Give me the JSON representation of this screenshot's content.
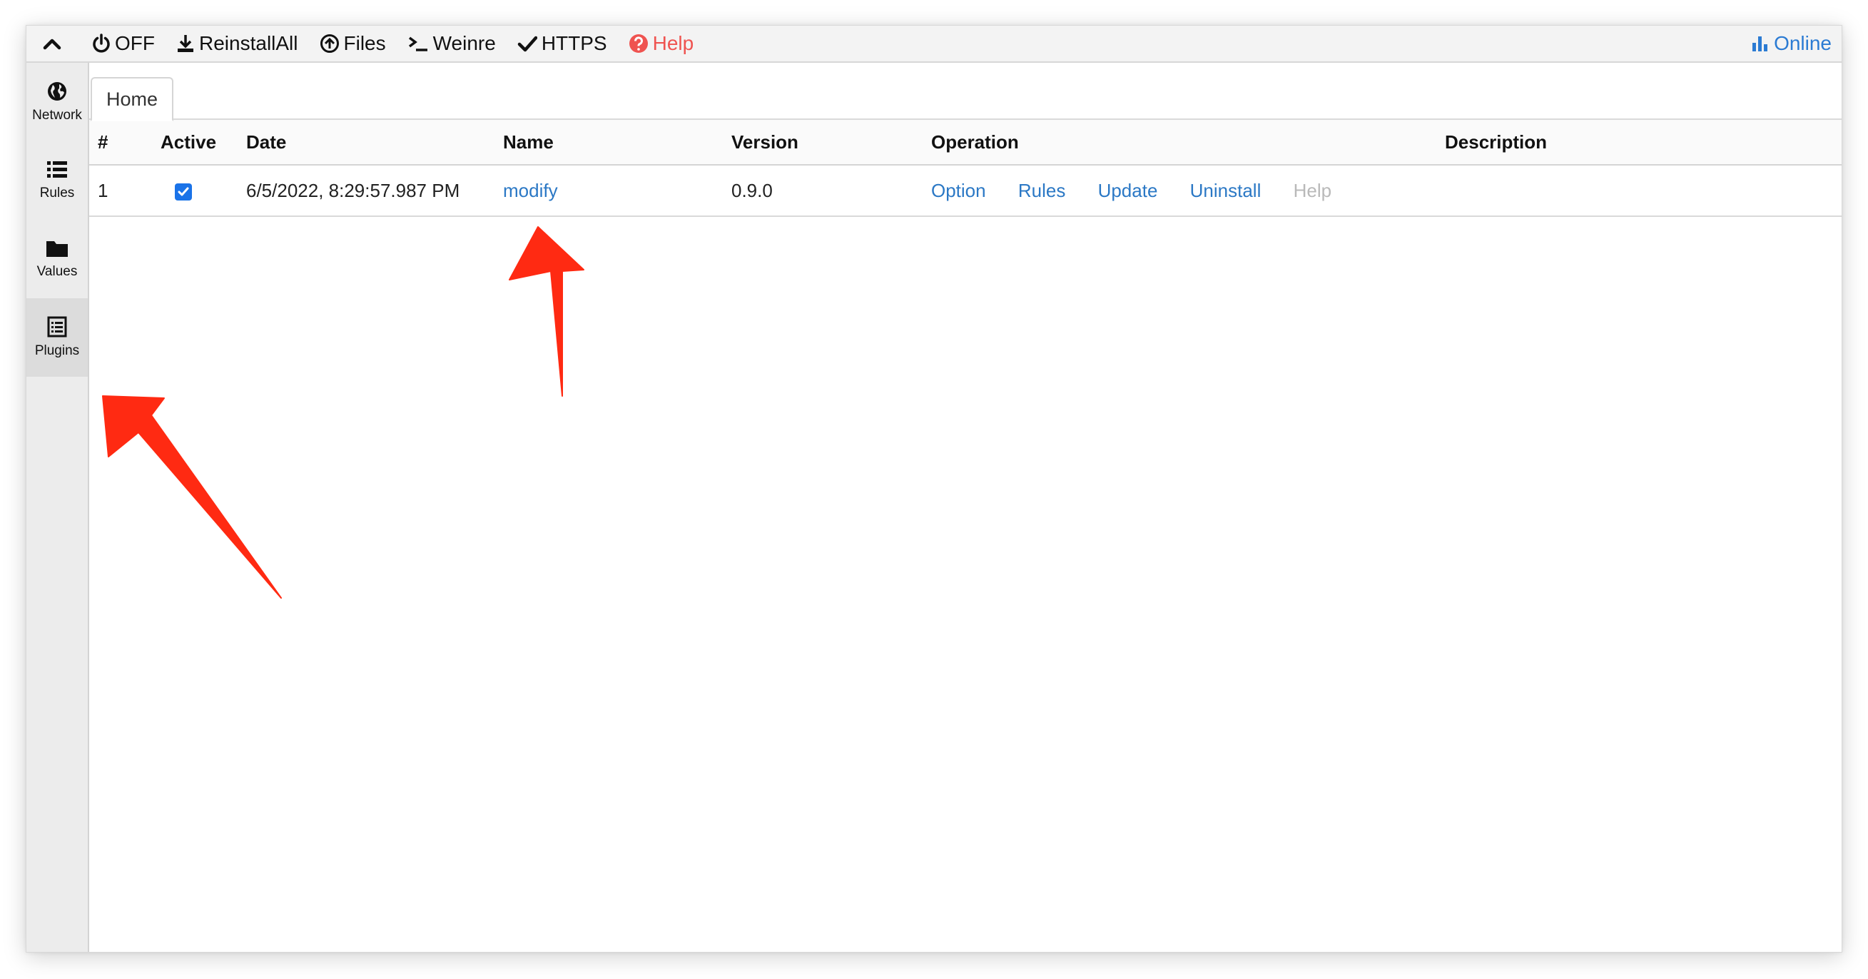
{
  "toolbar": {
    "items": [
      {
        "label": "OFF",
        "icon": "power-icon"
      },
      {
        "label": "ReinstallAll",
        "icon": "download-icon"
      },
      {
        "label": "Files",
        "icon": "upload-circle-icon"
      },
      {
        "label": "Weinre",
        "icon": "terminal-icon"
      },
      {
        "label": "HTTPS",
        "icon": "check-icon"
      },
      {
        "label": "Help",
        "icon": "question-circle-icon"
      }
    ],
    "online_label": "Online"
  },
  "sidebar": {
    "items": [
      {
        "label": "Network",
        "icon": "globe-icon"
      },
      {
        "label": "Rules",
        "icon": "list-icon"
      },
      {
        "label": "Values",
        "icon": "folder-icon"
      },
      {
        "label": "Plugins",
        "icon": "plugins-icon"
      }
    ],
    "active": "Plugins"
  },
  "tabs": [
    {
      "label": "Home"
    }
  ],
  "table": {
    "headers": [
      "#",
      "Active",
      "Date",
      "Name",
      "Version",
      "Operation",
      "Description"
    ],
    "rows": [
      {
        "index": "1",
        "active": true,
        "date": "6/5/2022, 8:29:57.987 PM",
        "name": "modify",
        "version": "0.9.0",
        "operations": [
          "Option",
          "Rules",
          "Update",
          "Uninstall",
          "Help"
        ],
        "description": ""
      }
    ]
  },
  "colors": {
    "link": "#2b78c5",
    "help": "#ef5350",
    "annotation_arrow": "#ff2a12",
    "checkbox": "#1a73e8"
  }
}
